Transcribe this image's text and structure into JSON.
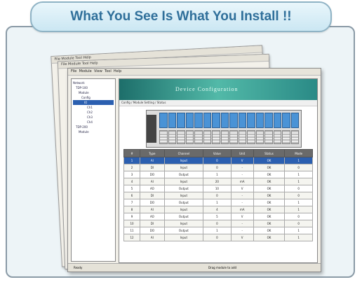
{
  "header": {
    "title": "What You See Is What You Install !!"
  },
  "windows": {
    "menu_items": [
      "File",
      "Module",
      "View",
      "Tool",
      "Help"
    ],
    "back_menu": "File  Module  Tool  Help",
    "tree": {
      "root": "Network",
      "items": [
        "Network",
        "TDP-100",
        "Module",
        "Config",
        "IO",
        "Ch1",
        "Ch2",
        "Ch3",
        "Ch4",
        "TDP-200",
        "Module"
      ]
    },
    "banner_text": "Device Configuration",
    "path_text": "Config / Module Setting / Status",
    "table": {
      "headers": [
        "#",
        "Type",
        "Channel",
        "Value",
        "Unit",
        "Status",
        "Mode"
      ],
      "rows": [
        [
          "1",
          "AI",
          "Input",
          "0",
          "V",
          "OK",
          "1"
        ],
        [
          "2",
          "DI",
          "Input",
          "0",
          "-",
          "OK",
          "0"
        ],
        [
          "3",
          "DO",
          "Output",
          "1",
          "-",
          "OK",
          "1"
        ],
        [
          "4",
          "AI",
          "Input",
          "20",
          "mA",
          "OK",
          "1"
        ],
        [
          "5",
          "AO",
          "Output",
          "10",
          "V",
          "OK",
          "0"
        ],
        [
          "6",
          "DI",
          "Input",
          "0",
          "-",
          "OK",
          "0"
        ],
        [
          "7",
          "DO",
          "Output",
          "1",
          "-",
          "OK",
          "1"
        ],
        [
          "8",
          "AI",
          "Input",
          "4",
          "mA",
          "OK",
          "1"
        ],
        [
          "9",
          "AO",
          "Output",
          "5",
          "V",
          "OK",
          "0"
        ],
        [
          "10",
          "DI",
          "Input",
          "0",
          "-",
          "OK",
          "0"
        ],
        [
          "11",
          "DO",
          "Output",
          "1",
          "-",
          "OK",
          "1"
        ],
        [
          "12",
          "AI",
          "Input",
          "0",
          "V",
          "OK",
          "1"
        ]
      ]
    },
    "status_left": "Ready",
    "status_hint": "Drag module to add"
  }
}
